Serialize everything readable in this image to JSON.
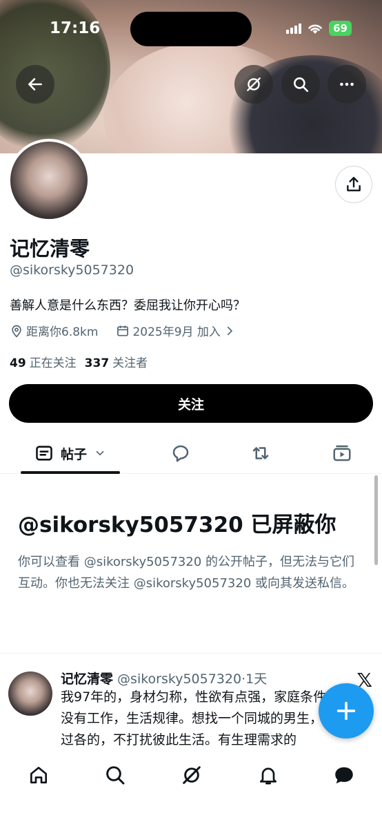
{
  "status_bar": {
    "time": "17:16",
    "battery": "69"
  },
  "profile": {
    "name": "记忆清零",
    "handle": "@sikorsky5057320",
    "bio": "善解人意是什么东西？委屈我让你开心吗？",
    "location": "距离你6.8km",
    "joined": "2025年9月 加入",
    "following_count": "49",
    "following_label": "正在关注",
    "followers_count": "337",
    "followers_label": "关注者"
  },
  "follow_button": {
    "label": "关注"
  },
  "tabs": {
    "posts_label": "帖子"
  },
  "blocked": {
    "title": "@sikorsky5057320 已屏蔽你",
    "description": "你可以查看 @sikorsky5057320 的公开帖子，但无法与它们互动。你也无法关注 @sikorsky5057320 或向其发送私信。"
  },
  "post": {
    "author": "记忆清零",
    "meta": " @sikorsky5057320·1天",
    "text": "我97年的，身材匀称，性欲有点强，家庭条件一般，没有工作，生活规律。想找一个同城的男生，平时各过各的，不打扰彼此生活。有生理需求的"
  },
  "colors": {
    "accent": "#1d9bf0",
    "battery": "#49d35f",
    "text_secondary": "#536471"
  }
}
